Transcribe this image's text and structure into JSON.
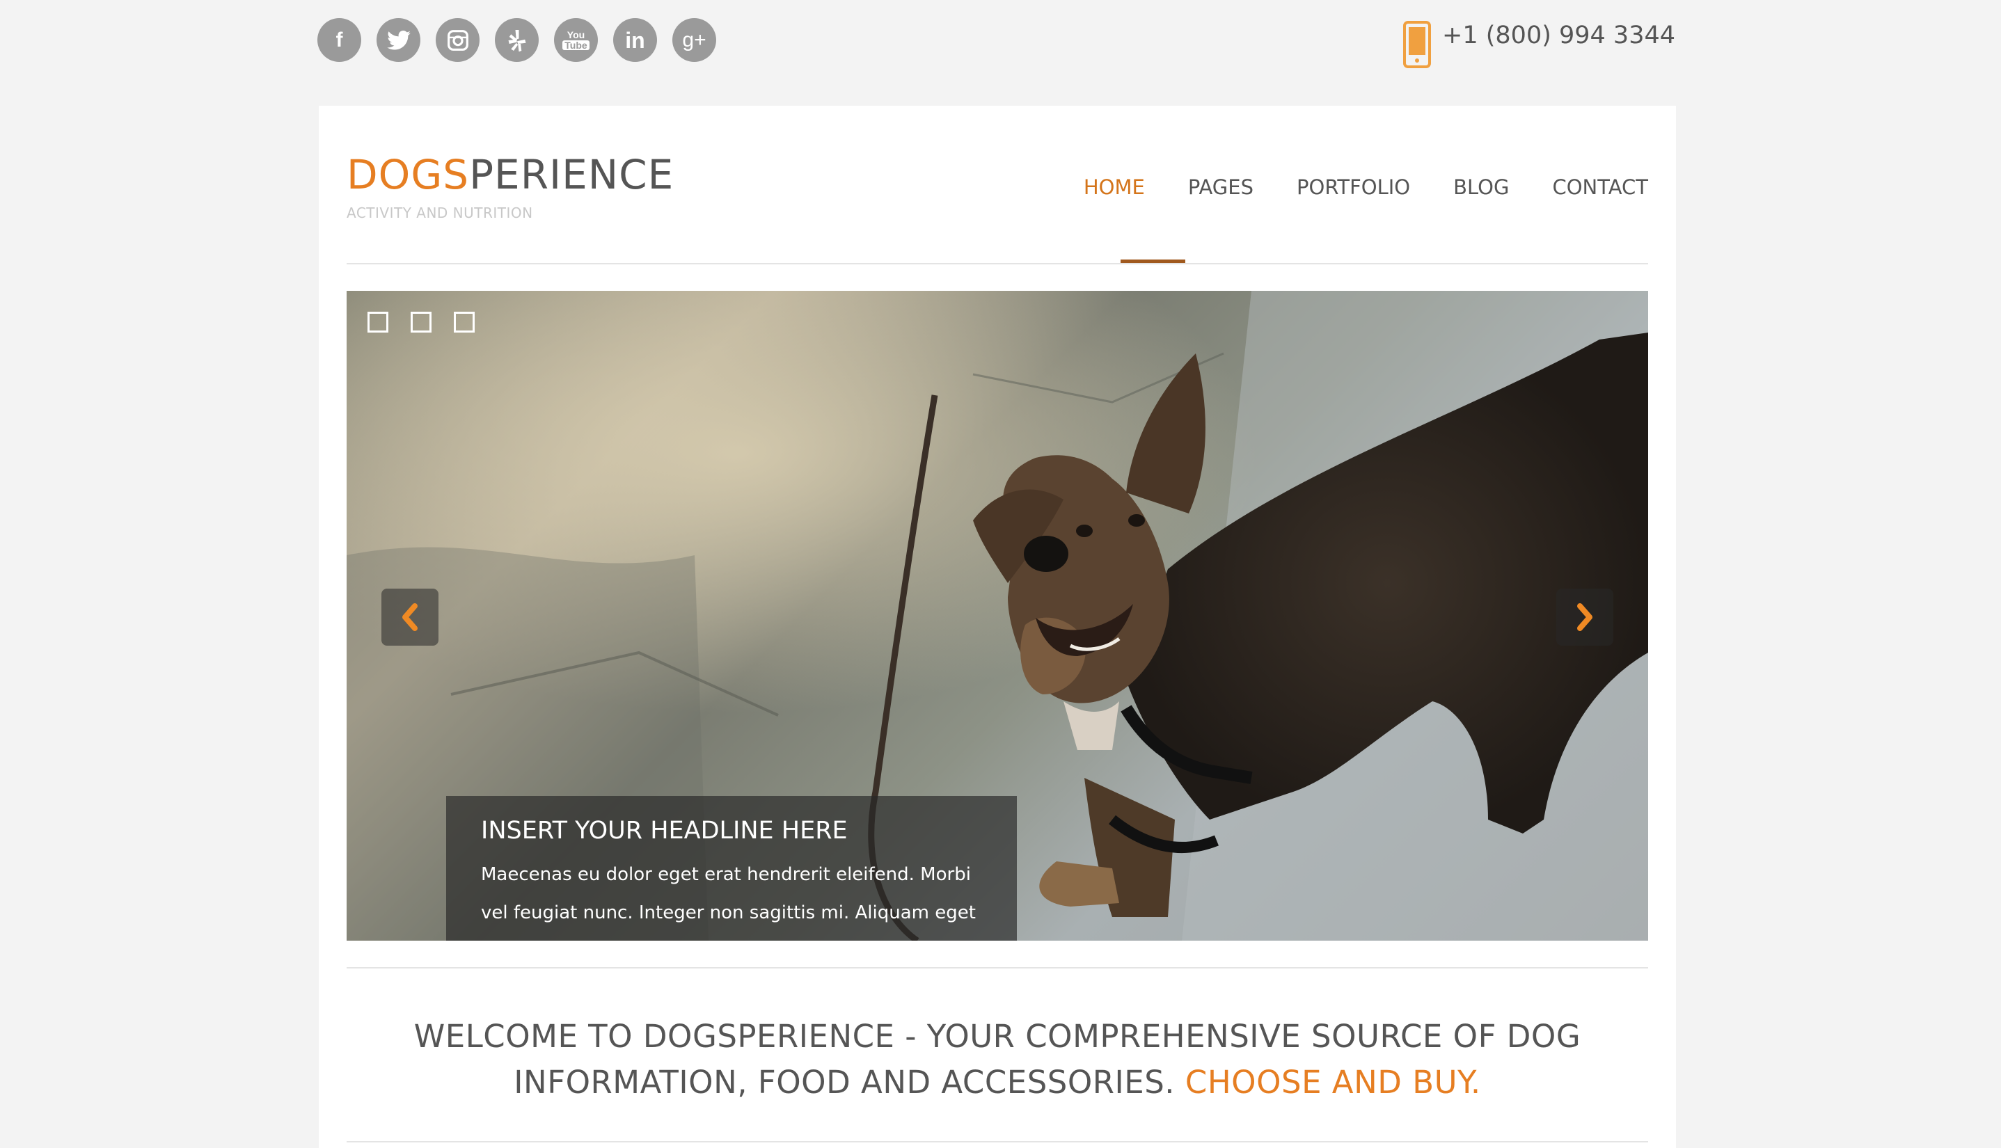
{
  "social": {
    "icons": [
      "facebook-icon",
      "twitter-icon",
      "instagram-icon",
      "yelp-icon",
      "youtube-icon",
      "linkedin-icon",
      "google-plus-icon"
    ],
    "glyphs": [
      "f",
      "🐦",
      "◘",
      "✻",
      "You Tube",
      "in",
      "g+"
    ]
  },
  "contact": {
    "phone": "+1 (800) 994 3344"
  },
  "brand": {
    "name_accent": "DOGS",
    "name_rest": "PERIENCE",
    "tagline": "ACTIVITY AND NUTRITION"
  },
  "nav": {
    "items": [
      "HOME",
      "PAGES",
      "PORTFOLIO",
      "BLOG",
      "CONTACT"
    ],
    "active": "HOME"
  },
  "slider": {
    "slides_count": 3,
    "caption": {
      "headline": "INSERT YOUR HEADLINE HERE",
      "text": "Maecenas eu dolor eget erat hendrerit eleifend. Morbi vel feugiat nunc. Integer non sagittis mi. Aliquam eget orci cursus neque faucibus iaculis nec nec arcu. Fusce finibus ante sit amet."
    }
  },
  "welcome": {
    "text": "WELCOME TO DOGSPERIENCE - YOUR COMPREHENSIVE SOURCE OF DOG INFORMATION, FOOD AND ACCESSORIES.",
    "accent": "CHOOSE AND BUY."
  },
  "colors": {
    "accent": "#e67e22",
    "nav_active": "#d4741a",
    "icon_gray": "#9a9a9a",
    "text": "#555555",
    "page_bg": "#f3f3f3"
  }
}
